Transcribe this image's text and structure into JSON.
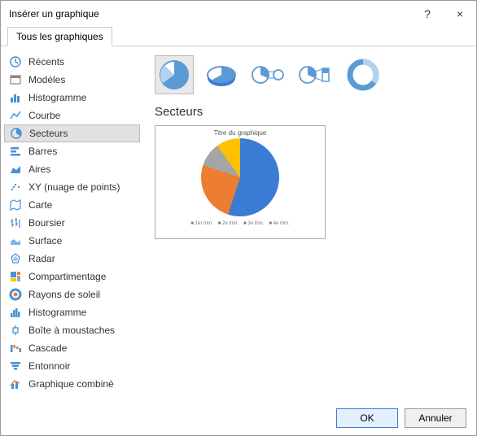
{
  "window": {
    "title": "Insérer un graphique",
    "help": "?",
    "close": "×"
  },
  "tab": {
    "label": "Tous les graphiques"
  },
  "sidebar": {
    "items": [
      {
        "label": "Récents"
      },
      {
        "label": "Modèles"
      },
      {
        "label": "Histogramme"
      },
      {
        "label": "Courbe"
      },
      {
        "label": "Secteurs"
      },
      {
        "label": "Barres"
      },
      {
        "label": "Aires"
      },
      {
        "label": "XY (nuage de points)"
      },
      {
        "label": "Carte"
      },
      {
        "label": "Boursier"
      },
      {
        "label": "Surface"
      },
      {
        "label": "Radar"
      },
      {
        "label": "Compartimentage"
      },
      {
        "label": "Rayons de soleil"
      },
      {
        "label": "Histogramme"
      },
      {
        "label": "Boîte à moustaches"
      },
      {
        "label": "Cascade"
      },
      {
        "label": "Entonnoir"
      },
      {
        "label": "Graphique combiné"
      }
    ],
    "selected_index": 4
  },
  "subtypes": {
    "selected_index": 0,
    "names": [
      "pie",
      "pie-3d",
      "pie-of-pie",
      "bar-of-pie",
      "doughnut"
    ]
  },
  "section_title": "Secteurs",
  "preview": {
    "title": "Titre du graphique",
    "legend": [
      "1er trim.",
      "2e trim.",
      "3e trim.",
      "4e trim."
    ]
  },
  "footer": {
    "ok": "OK",
    "cancel": "Annuler"
  },
  "colors": {
    "blue": "#3a7bd5",
    "orange": "#ed7d31",
    "grey": "#a5a5a5",
    "yellow": "#ffc000"
  },
  "chart_data": {
    "type": "pie",
    "categories": [
      "1er trim.",
      "2e trim.",
      "3e trim.",
      "4e trim."
    ],
    "values": [
      55,
      25,
      10,
      10
    ],
    "title": "Titre du graphique",
    "colors": [
      "#3a7bd5",
      "#ed7d31",
      "#a5a5a5",
      "#ffc000"
    ]
  }
}
